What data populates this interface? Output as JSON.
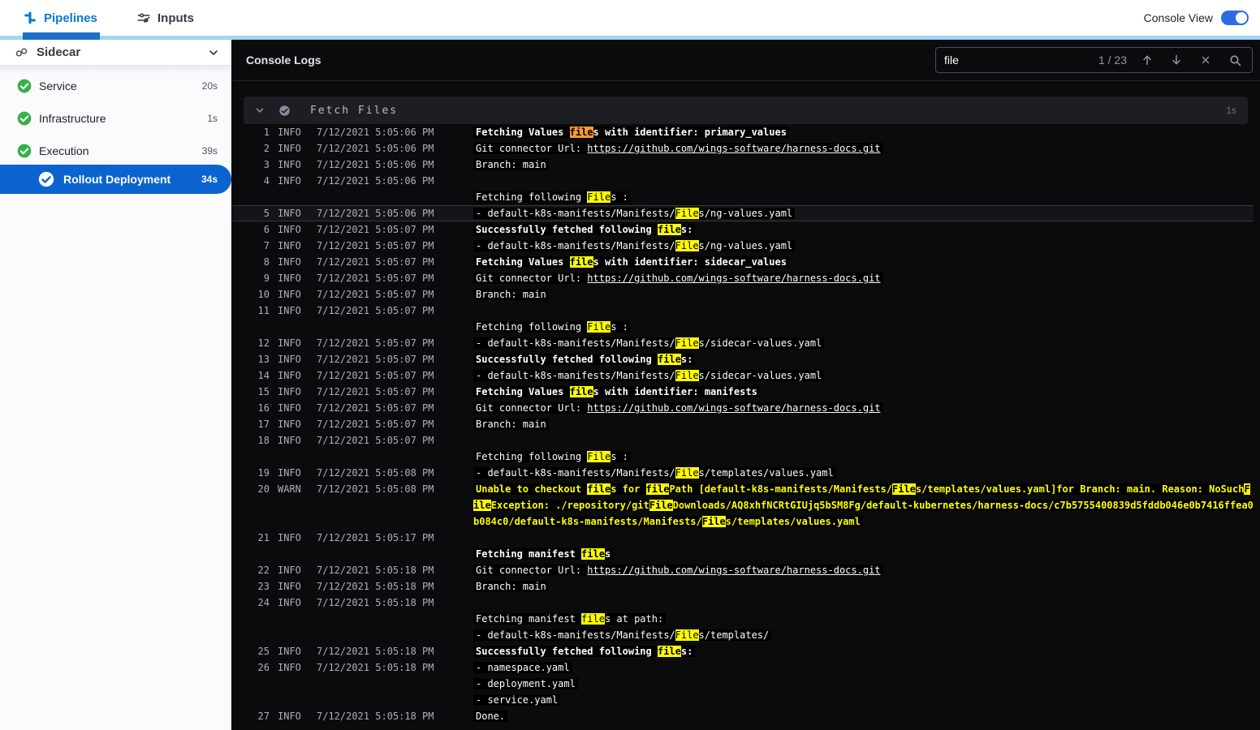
{
  "topbar": {
    "tabs": [
      {
        "label": "Pipelines",
        "active": true
      },
      {
        "label": "Inputs",
        "active": false
      }
    ],
    "console_view_label": "Console View",
    "console_view_on": true
  },
  "sidebar": {
    "pipeline_name": "Sidecar",
    "stages": [
      {
        "label": "Service",
        "duration": "20s",
        "status": "success"
      },
      {
        "label": "Infrastructure",
        "duration": "1s",
        "status": "success"
      },
      {
        "label": "Execution",
        "duration": "39s",
        "status": "success"
      }
    ],
    "selected_step": {
      "label": "Rollout Deployment",
      "duration": "34s"
    }
  },
  "console": {
    "title": "Console Logs",
    "search": {
      "query": "file",
      "counter": "1 / 23",
      "current_match_index": 0
    },
    "section": {
      "title": "Fetch Files",
      "duration": "1s"
    },
    "entries": [
      {
        "num": "1",
        "level": "INFO",
        "time": "7/12/2021 5:05:06 PM",
        "lines": [
          {
            "text": "Fetching Values files with identifier: primary_values",
            "bold": true
          }
        ]
      },
      {
        "num": "2",
        "level": "INFO",
        "time": "7/12/2021 5:05:06 PM",
        "lines": [
          {
            "prefix": "Git connector Url: ",
            "link": "https://github.com/wings-software/harness-docs.git"
          }
        ]
      },
      {
        "num": "3",
        "level": "INFO",
        "time": "7/12/2021 5:05:06 PM",
        "lines": [
          {
            "text": "Branch: main"
          }
        ]
      },
      {
        "num": "4",
        "level": "INFO",
        "time": "7/12/2021 5:05:06 PM",
        "lines": [
          {
            "text": ""
          },
          {
            "text": "Fetching following Files :"
          }
        ]
      },
      {
        "num": "5",
        "level": "INFO",
        "time": "7/12/2021 5:05:06 PM",
        "active": true,
        "lines": [
          {
            "text": "- default-k8s-manifests/Manifests/Files/ng-values.yaml"
          }
        ]
      },
      {
        "num": "6",
        "level": "INFO",
        "time": "7/12/2021 5:05:07 PM",
        "lines": [
          {
            "text": "Successfully fetched following files:",
            "bold": true
          }
        ]
      },
      {
        "num": "7",
        "level": "INFO",
        "time": "7/12/2021 5:05:07 PM",
        "lines": [
          {
            "text": "- default-k8s-manifests/Manifests/Files/ng-values.yaml"
          }
        ]
      },
      {
        "num": "8",
        "level": "INFO",
        "time": "7/12/2021 5:05:07 PM",
        "lines": [
          {
            "text": "Fetching Values files with identifier: sidecar_values",
            "bold": true
          }
        ]
      },
      {
        "num": "9",
        "level": "INFO",
        "time": "7/12/2021 5:05:07 PM",
        "lines": [
          {
            "prefix": "Git connector Url: ",
            "link": "https://github.com/wings-software/harness-docs.git"
          }
        ]
      },
      {
        "num": "10",
        "level": "INFO",
        "time": "7/12/2021 5:05:07 PM",
        "lines": [
          {
            "text": "Branch: main"
          }
        ]
      },
      {
        "num": "11",
        "level": "INFO",
        "time": "7/12/2021 5:05:07 PM",
        "lines": [
          {
            "text": ""
          },
          {
            "text": "Fetching following Files :"
          }
        ]
      },
      {
        "num": "12",
        "level": "INFO",
        "time": "7/12/2021 5:05:07 PM",
        "lines": [
          {
            "text": "- default-k8s-manifests/Manifests/Files/sidecar-values.yaml"
          }
        ]
      },
      {
        "num": "13",
        "level": "INFO",
        "time": "7/12/2021 5:05:07 PM",
        "lines": [
          {
            "text": "Successfully fetched following files:",
            "bold": true
          }
        ]
      },
      {
        "num": "14",
        "level": "INFO",
        "time": "7/12/2021 5:05:07 PM",
        "lines": [
          {
            "text": "- default-k8s-manifests/Manifests/Files/sidecar-values.yaml"
          }
        ]
      },
      {
        "num": "15",
        "level": "INFO",
        "time": "7/12/2021 5:05:07 PM",
        "lines": [
          {
            "text": "Fetching Values files with identifier: manifests",
            "bold": true
          }
        ]
      },
      {
        "num": "16",
        "level": "INFO",
        "time": "7/12/2021 5:05:07 PM",
        "lines": [
          {
            "prefix": "Git connector Url: ",
            "link": "https://github.com/wings-software/harness-docs.git"
          }
        ]
      },
      {
        "num": "17",
        "level": "INFO",
        "time": "7/12/2021 5:05:07 PM",
        "lines": [
          {
            "text": "Branch: main"
          }
        ]
      },
      {
        "num": "18",
        "level": "INFO",
        "time": "7/12/2021 5:05:07 PM",
        "lines": [
          {
            "text": ""
          },
          {
            "text": "Fetching following Files :"
          }
        ]
      },
      {
        "num": "19",
        "level": "INFO",
        "time": "7/12/2021 5:05:08 PM",
        "lines": [
          {
            "text": "- default-k8s-manifests/Manifests/Files/templates/values.yaml"
          }
        ]
      },
      {
        "num": "20",
        "level": "WARN",
        "time": "7/12/2021 5:05:08 PM",
        "lines": [
          {
            "text": "Unable to checkout files for filePath [default-k8s-manifests/Manifests/Files/templates/values.yaml]for Branch: main. Reason: NoSuchFileException: ./repository/gitFileDownloads/AQ8xhfNCRtGIUjq5bSM8Fg/default-kubernetes/harness-docs/c7b5755400839d5fddb046e0b7416ffea0b084c0/default-k8s-manifests/Manifests/Files/templates/values.yaml",
            "warn": true
          }
        ]
      },
      {
        "num": "21",
        "level": "INFO",
        "time": "7/12/2021 5:05:17 PM",
        "lines": [
          {
            "text": ""
          },
          {
            "text": "Fetching manifest files",
            "bold": true
          }
        ]
      },
      {
        "num": "22",
        "level": "INFO",
        "time": "7/12/2021 5:05:18 PM",
        "lines": [
          {
            "prefix": "Git connector Url: ",
            "link": "https://github.com/wings-software/harness-docs.git"
          }
        ]
      },
      {
        "num": "23",
        "level": "INFO",
        "time": "7/12/2021 5:05:18 PM",
        "lines": [
          {
            "text": "Branch: main"
          }
        ]
      },
      {
        "num": "24",
        "level": "INFO",
        "time": "7/12/2021 5:05:18 PM",
        "lines": [
          {
            "text": ""
          },
          {
            "text": "Fetching manifest files at path:"
          },
          {
            "text": "- default-k8s-manifests/Manifests/Files/templates/"
          }
        ]
      },
      {
        "num": "25",
        "level": "INFO",
        "time": "7/12/2021 5:05:18 PM",
        "lines": [
          {
            "text": "Successfully fetched following files:",
            "bold": true
          }
        ]
      },
      {
        "num": "26",
        "level": "INFO",
        "time": "7/12/2021 5:05:18 PM",
        "lines": [
          {
            "text": "- namespace.yaml"
          },
          {
            "text": "- deployment.yaml"
          },
          {
            "text": "- service.yaml"
          }
        ]
      },
      {
        "num": "27",
        "level": "INFO",
        "time": "7/12/2021 5:05:18 PM",
        "lines": [
          {
            "text": "Done."
          }
        ]
      }
    ]
  },
  "colors": {
    "brand_blue": "#0278d5",
    "tab_underline": "#1b6fc9",
    "accent_strip": "#9ed6f0",
    "success_green": "#35b04b",
    "selected_step_blue": "#0b63cf",
    "console_bg": "#0b0b0e",
    "match_highlight": "#ffff00",
    "match_current": "#ff9a2e",
    "warn_text": "#ffff00"
  }
}
